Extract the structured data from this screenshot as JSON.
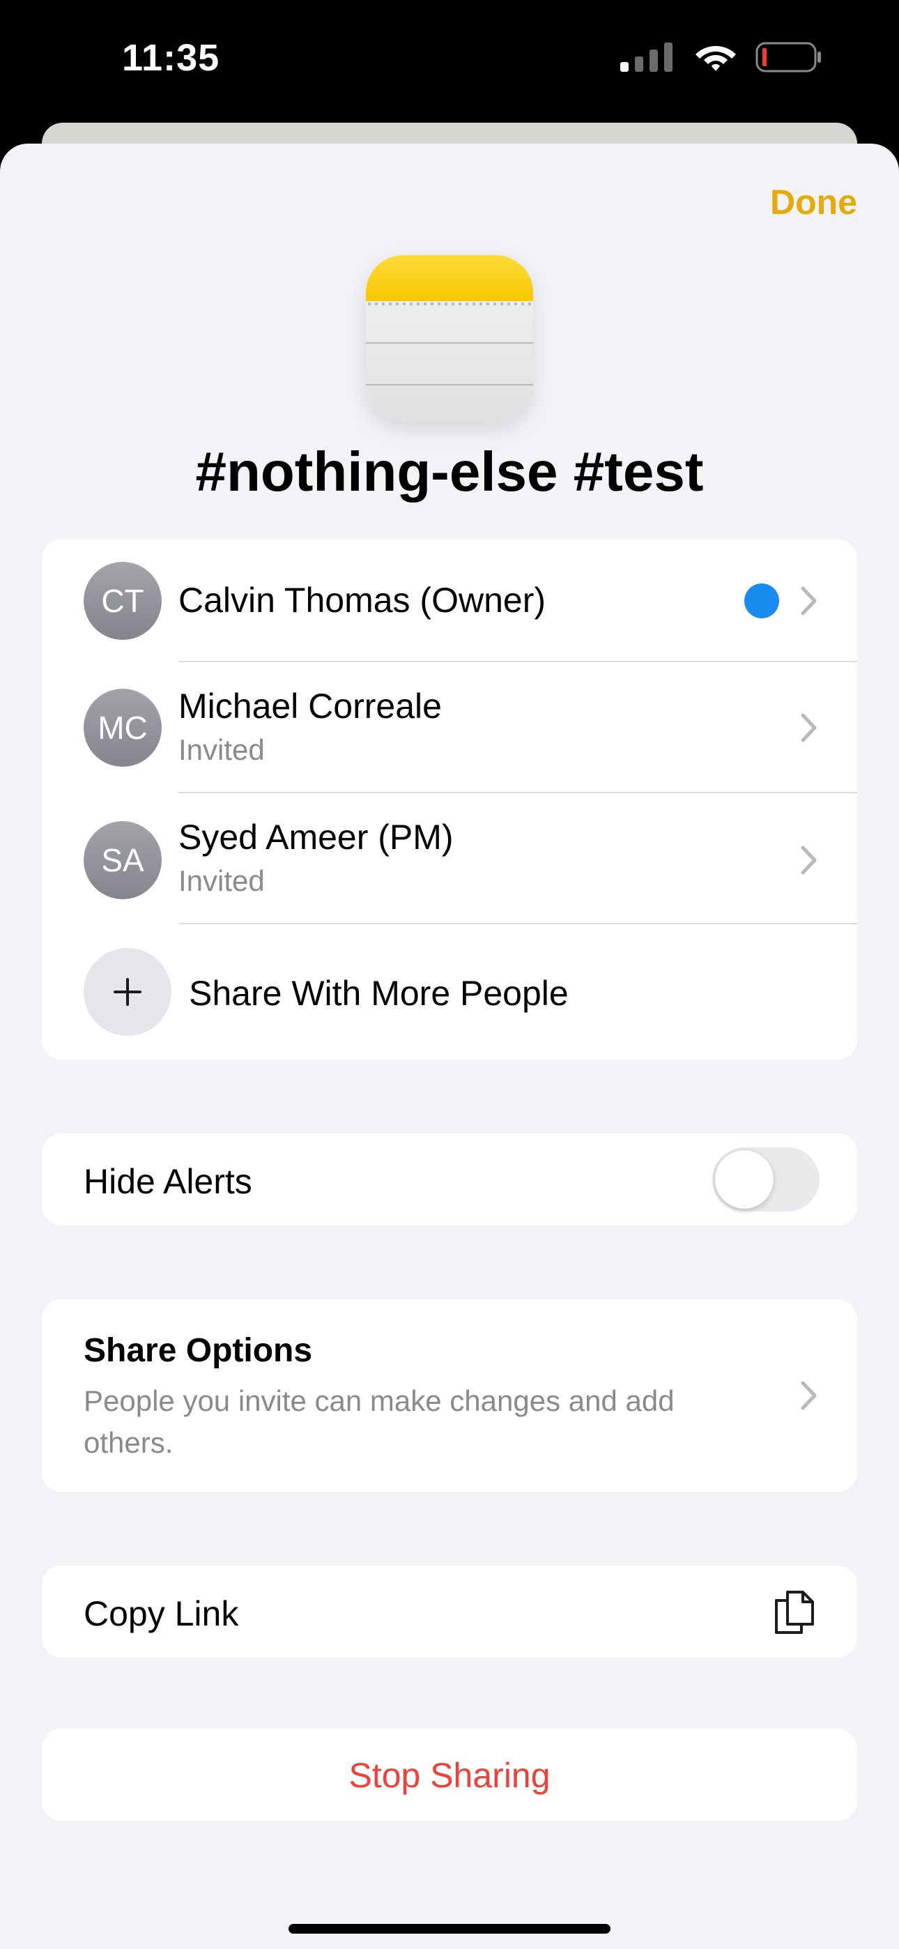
{
  "status_bar": {
    "time": "11:35",
    "icons": [
      "cellular-signal-icon",
      "wifi-icon",
      "battery-low-icon"
    ]
  },
  "header": {
    "done_label": "Done"
  },
  "note": {
    "app_icon": "notes-app-icon",
    "title": "#nothing-else #test"
  },
  "people": {
    "participants": [
      {
        "initials": "CT",
        "name": "Calvin Thomas (Owner)",
        "status": "",
        "has_activity_dot": true
      },
      {
        "initials": "MC",
        "name": "Michael Correale",
        "status": "Invited",
        "has_activity_dot": false
      },
      {
        "initials": "SA",
        "name": "Syed Ameer (PM)",
        "status": "Invited",
        "has_activity_dot": false
      }
    ],
    "share_more_label": "Share With More People"
  },
  "alerts": {
    "label": "Hide Alerts",
    "enabled": false
  },
  "share_options": {
    "title": "Share Options",
    "description": "People you invite can make changes and add others."
  },
  "copy_link": {
    "label": "Copy Link",
    "icon": "copy-documents-icon"
  },
  "stop_sharing": {
    "label": "Stop Sharing"
  },
  "colors": {
    "accent": "#e3ac0b",
    "destructive": "#f0403a",
    "activity_dot": "#1a8cf0",
    "background": "#f2f2f7",
    "secondary_text": "#8a8a8e"
  }
}
